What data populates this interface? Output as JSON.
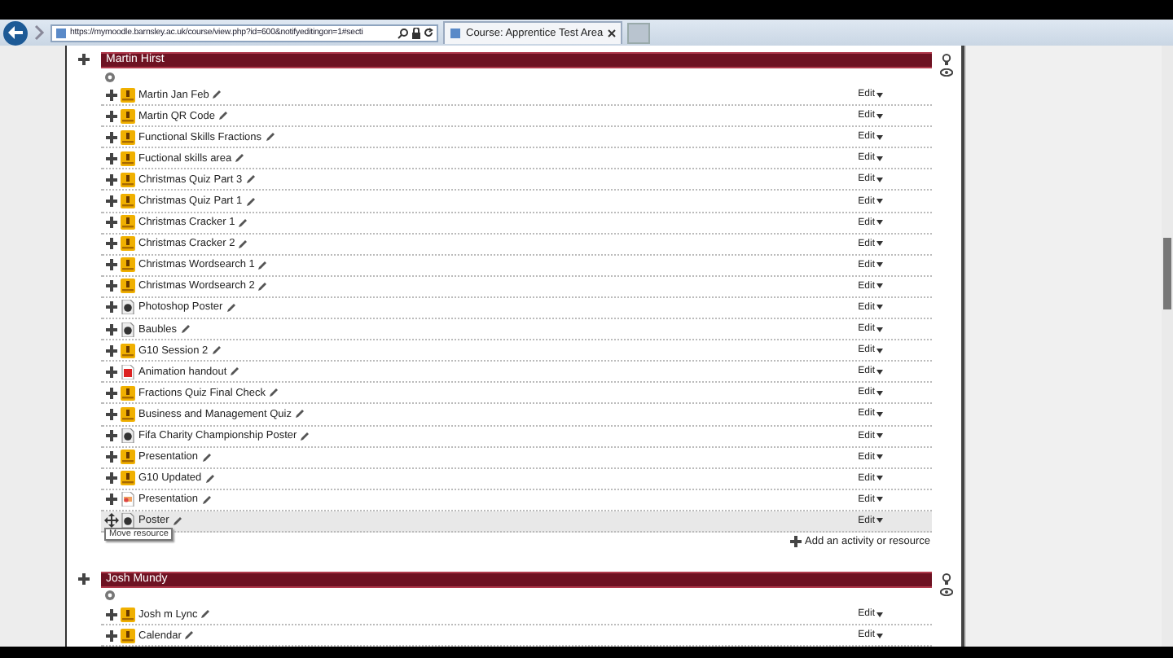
{
  "browser": {
    "url": "https://mymoodle.barnsley.ac.uk/course/view.php?id=600&notifyeditingon=1#secti",
    "tabs": [
      {
        "title": "Course: Apprentice Test Area",
        "selected": true
      }
    ]
  },
  "sections": [
    {
      "name": "Martin Hirst",
      "add_link": "Add an activity or resource",
      "items": [
        {
          "title": "Martin Jan Feb",
          "kind": "quiz",
          "action": "Edit",
          "hovered": false
        },
        {
          "title": "Martin QR Code",
          "kind": "quiz",
          "action": "Edit",
          "hovered": false
        },
        {
          "title": "Functional Skills Fractions",
          "kind": "quiz",
          "action": "Edit",
          "hovered": false
        },
        {
          "title": "Fuctional skills area",
          "kind": "quiz",
          "action": "Edit",
          "hovered": false
        },
        {
          "title": "Christmas Quiz Part 3",
          "kind": "quiz",
          "action": "Edit",
          "hovered": false
        },
        {
          "title": "Christmas Quiz Part 1",
          "kind": "quiz",
          "action": "Edit",
          "hovered": false
        },
        {
          "title": "Christmas Cracker 1",
          "kind": "quiz",
          "action": "Edit",
          "hovered": false
        },
        {
          "title": "Christmas Cracker 2",
          "kind": "quiz",
          "action": "Edit",
          "hovered": false
        },
        {
          "title": "Christmas Wordsearch 1",
          "kind": "quiz",
          "action": "Edit",
          "hovered": false
        },
        {
          "title": "Christmas Wordsearch 2",
          "kind": "quiz",
          "action": "Edit",
          "hovered": false
        },
        {
          "title": "Photoshop Poster",
          "kind": "image",
          "action": "Edit",
          "hovered": false
        },
        {
          "title": "Baubles",
          "kind": "image",
          "action": "Edit",
          "hovered": false
        },
        {
          "title": "G10 Session 2",
          "kind": "quiz",
          "action": "Edit",
          "hovered": false
        },
        {
          "title": "Animation handout",
          "kind": "pdf",
          "action": "Edit",
          "hovered": false
        },
        {
          "title": "Fractions Quiz Final Check",
          "kind": "quiz",
          "action": "Edit",
          "hovered": false
        },
        {
          "title": "Business and Management Quiz",
          "kind": "quiz",
          "action": "Edit",
          "hovered": false
        },
        {
          "title": "Fifa Charity Championship Poster",
          "kind": "image",
          "action": "Edit",
          "hovered": false
        },
        {
          "title": "Presentation",
          "kind": "quiz",
          "action": "Edit",
          "hovered": false
        },
        {
          "title": "G10 Updated",
          "kind": "quiz",
          "action": "Edit",
          "hovered": false
        },
        {
          "title": "Presentation",
          "kind": "slides",
          "action": "Edit",
          "hovered": false
        },
        {
          "title": "Poster",
          "kind": "image",
          "action": "Edit",
          "hovered": true,
          "tooltip": "Move resource"
        }
      ]
    },
    {
      "name": "Josh Mundy",
      "items": [
        {
          "title": "Josh m Lync",
          "kind": "quiz",
          "action": "Edit",
          "hovered": false
        },
        {
          "title": "Calendar",
          "kind": "quiz",
          "action": "Edit",
          "hovered": false
        }
      ]
    }
  ]
}
